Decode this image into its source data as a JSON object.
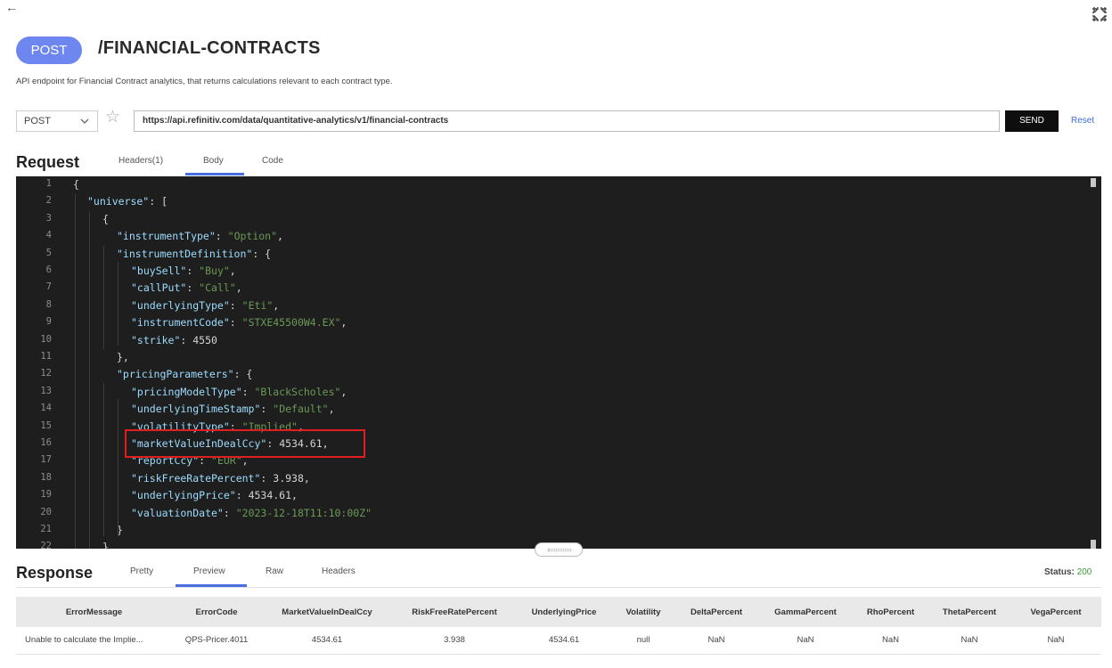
{
  "topbar": {
    "back_icon": "←",
    "expand_icon": "expand-arrows-icon"
  },
  "header": {
    "method_badge": "POST",
    "title": "/FINANCIAL-CONTRACTS",
    "description": "API endpoint for Financial Contract analytics, that returns calculations relevant to each contract type."
  },
  "request_bar": {
    "method": "POST",
    "url": "https://api.refinitiv.com/data/quantitative-analytics/v1/financial-contracts",
    "send_label": "SEND",
    "reset_label": "Reset",
    "star_icon": "☆"
  },
  "request": {
    "title": "Request",
    "tabs": [
      "Headers(1)",
      "Body",
      "Code"
    ],
    "active_tab": "Body"
  },
  "editor": {
    "line_numbers": [
      "1",
      "2",
      "3",
      "4",
      "5",
      "6",
      "7",
      "8",
      "9",
      "10",
      "11",
      "12",
      "13",
      "14",
      "15",
      "16",
      "17",
      "18",
      "19",
      "20",
      "21",
      "22"
    ],
    "lines": [
      [
        {
          "t": "p",
          "v": "{"
        }
      ],
      [
        {
          "t": "k",
          "v": "\"universe\""
        },
        {
          "t": "p",
          "v": ": ["
        }
      ],
      [
        {
          "t": "p",
          "v": "{"
        }
      ],
      [
        {
          "t": "k",
          "v": "\"instrumentType\""
        },
        {
          "t": "p",
          "v": ": "
        },
        {
          "t": "s",
          "v": "\"Option\""
        },
        {
          "t": "p",
          "v": ","
        }
      ],
      [
        {
          "t": "k",
          "v": "\"instrumentDefinition\""
        },
        {
          "t": "p",
          "v": ": {"
        }
      ],
      [
        {
          "t": "k",
          "v": "\"buySell\""
        },
        {
          "t": "p",
          "v": ": "
        },
        {
          "t": "s",
          "v": "\"Buy\""
        },
        {
          "t": "p",
          "v": ","
        }
      ],
      [
        {
          "t": "k",
          "v": "\"callPut\""
        },
        {
          "t": "p",
          "v": ": "
        },
        {
          "t": "s",
          "v": "\"Call\""
        },
        {
          "t": "p",
          "v": ","
        }
      ],
      [
        {
          "t": "k",
          "v": "\"underlyingType\""
        },
        {
          "t": "p",
          "v": ": "
        },
        {
          "t": "s",
          "v": "\"Eti\""
        },
        {
          "t": "p",
          "v": ","
        }
      ],
      [
        {
          "t": "k",
          "v": "\"instrumentCode\""
        },
        {
          "t": "p",
          "v": ": "
        },
        {
          "t": "s",
          "v": "\"STXE45500W4.EX\""
        },
        {
          "t": "p",
          "v": ","
        }
      ],
      [
        {
          "t": "k",
          "v": "\"strike\""
        },
        {
          "t": "p",
          "v": ": "
        },
        {
          "t": "n",
          "v": "4550"
        }
      ],
      [
        {
          "t": "p",
          "v": "},"
        }
      ],
      [
        {
          "t": "k",
          "v": "\"pricingParameters\""
        },
        {
          "t": "p",
          "v": ": {"
        }
      ],
      [
        {
          "t": "k",
          "v": "\"pricingModelType\""
        },
        {
          "t": "p",
          "v": ": "
        },
        {
          "t": "s",
          "v": "\"BlackScholes\""
        },
        {
          "t": "p",
          "v": ","
        }
      ],
      [
        {
          "t": "k",
          "v": "\"underlyingTimeStamp\""
        },
        {
          "t": "p",
          "v": ": "
        },
        {
          "t": "s",
          "v": "\"Default\""
        },
        {
          "t": "p",
          "v": ","
        }
      ],
      [
        {
          "t": "k",
          "v": "\"volatilityType\""
        },
        {
          "t": "p",
          "v": ": "
        },
        {
          "t": "s",
          "v": "\"Implied\""
        },
        {
          "t": "p",
          "v": ","
        }
      ],
      [
        {
          "t": "k",
          "v": "\"marketValueInDealCcy\""
        },
        {
          "t": "p",
          "v": ": "
        },
        {
          "t": "n",
          "v": "4534.61"
        },
        {
          "t": "p",
          "v": ","
        }
      ],
      [
        {
          "t": "k",
          "v": "\"reportCcy\""
        },
        {
          "t": "p",
          "v": ": "
        },
        {
          "t": "s",
          "v": "\"EUR\""
        },
        {
          "t": "p",
          "v": ","
        }
      ],
      [
        {
          "t": "k",
          "v": "\"riskFreeRatePercent\""
        },
        {
          "t": "p",
          "v": ": "
        },
        {
          "t": "n",
          "v": "3.938"
        },
        {
          "t": "p",
          "v": ","
        }
      ],
      [
        {
          "t": "k",
          "v": "\"underlyingPrice\""
        },
        {
          "t": "p",
          "v": ": "
        },
        {
          "t": "n",
          "v": "4534.61"
        },
        {
          "t": "p",
          "v": ","
        }
      ],
      [
        {
          "t": "k",
          "v": "\"valuationDate\""
        },
        {
          "t": "p",
          "v": ": "
        },
        {
          "t": "s",
          "v": "\"2023-12-18T11:10:00Z\""
        }
      ],
      [
        {
          "t": "p",
          "v": "}"
        }
      ],
      [
        {
          "t": "p",
          "v": "}"
        }
      ]
    ]
  },
  "response": {
    "title": "Response",
    "tabs": [
      "Pretty",
      "Preview",
      "Raw",
      "Headers"
    ],
    "active_tab": "Preview",
    "status_label": "Status:",
    "status_code": "200",
    "columns": [
      "ErrorMessage",
      "ErrorCode",
      "MarketValueInDealCcy",
      "RiskFreeRatePercent",
      "UnderlyingPrice",
      "Volatility",
      "DeltaPercent",
      "GammaPercent",
      "RhoPercent",
      "ThetaPercent",
      "VegaPercent"
    ],
    "rows": [
      [
        "Unable to calculate the Implie...",
        "QPS-Pricer.4011",
        "4534.61",
        "3.938",
        "4534.61",
        "null",
        "NaN",
        "NaN",
        "NaN",
        "NaN",
        "NaN"
      ]
    ]
  },
  "colors": {
    "method_badge": "#6d86f0",
    "editor_bg": "#1e1e1e",
    "json_key": "#9cdcfe",
    "json_string": "#6a9955",
    "highlight_box": "#e01e1e",
    "active_tab": "#4a6ee0",
    "status_ok": "#3aa03a"
  }
}
